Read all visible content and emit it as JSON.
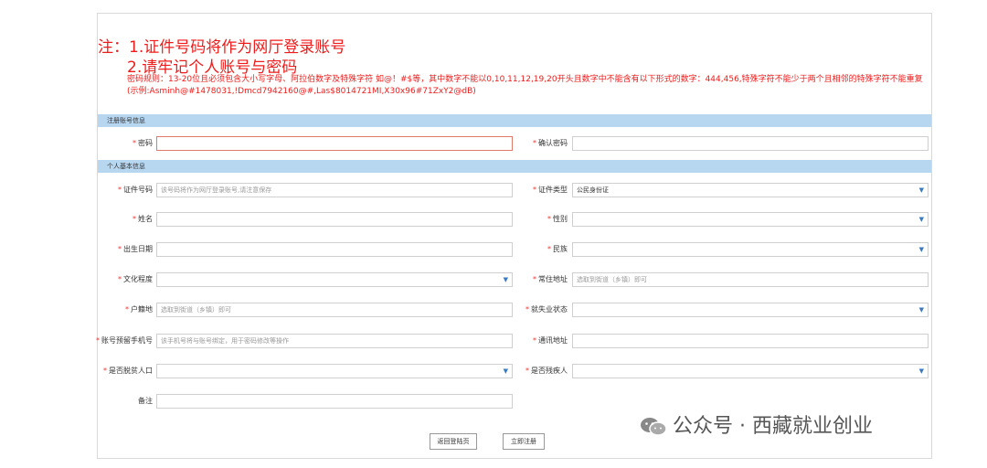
{
  "notice": {
    "line1": "注：1.证件号码将作为网厅登录账号",
    "line2": "2.请牢记个人账号与密码",
    "rule": "密码规则：13-20位且必须包含大小写字母、阿拉伯数字及特殊字符 如@！#$等，其中数字不能以0,10,11,12,19,20开头且数字中不能含有以下形式的数字：444,456,特殊字符不能少于两个且相邻的特殊字符不能重复(示例:Asminh@#1478031,!Dmcd7942160@#,Las$8014721MI,X30x96#71ZxY2@dB)"
  },
  "sections": {
    "account": "注册账号信息",
    "personal": "个人基本信息"
  },
  "required_mark": "*",
  "form": {
    "password": {
      "label": "密码"
    },
    "confirm_password": {
      "label": "确认密码"
    },
    "id_number": {
      "label": "证件号码",
      "placeholder": "该号码将作为网厅登录账号,请注意保存"
    },
    "id_type": {
      "label": "证件类型",
      "value": "公民身份证"
    },
    "name": {
      "label": "姓名"
    },
    "gender": {
      "label": "性别"
    },
    "birth_date": {
      "label": "出生日期"
    },
    "ethnicity": {
      "label": "民族"
    },
    "education": {
      "label": "文化程度"
    },
    "residence": {
      "label": "常住地址",
      "placeholder": "选取到街道（乡镇）即可"
    },
    "household": {
      "label": "户籍地",
      "placeholder": "选取到街道（乡镇）即可"
    },
    "employment": {
      "label": "就失业状态"
    },
    "phone": {
      "label": "账号预留手机号",
      "placeholder": "该手机号将与账号绑定，用于密码修改等操作"
    },
    "address": {
      "label": "通讯地址"
    },
    "poverty": {
      "label": "是否脱贫人口"
    },
    "disabled": {
      "label": "是否残疾人"
    },
    "remark": {
      "label": "备注"
    }
  },
  "buttons": {
    "back": "返回登陆页",
    "register": "立即注册"
  },
  "watermark": "公众号 · 西藏就业创业",
  "colors": {
    "notice_red": "#ee1c1c",
    "section_bg": "#b7d7f1",
    "caret_blue": "#3b78c2"
  }
}
